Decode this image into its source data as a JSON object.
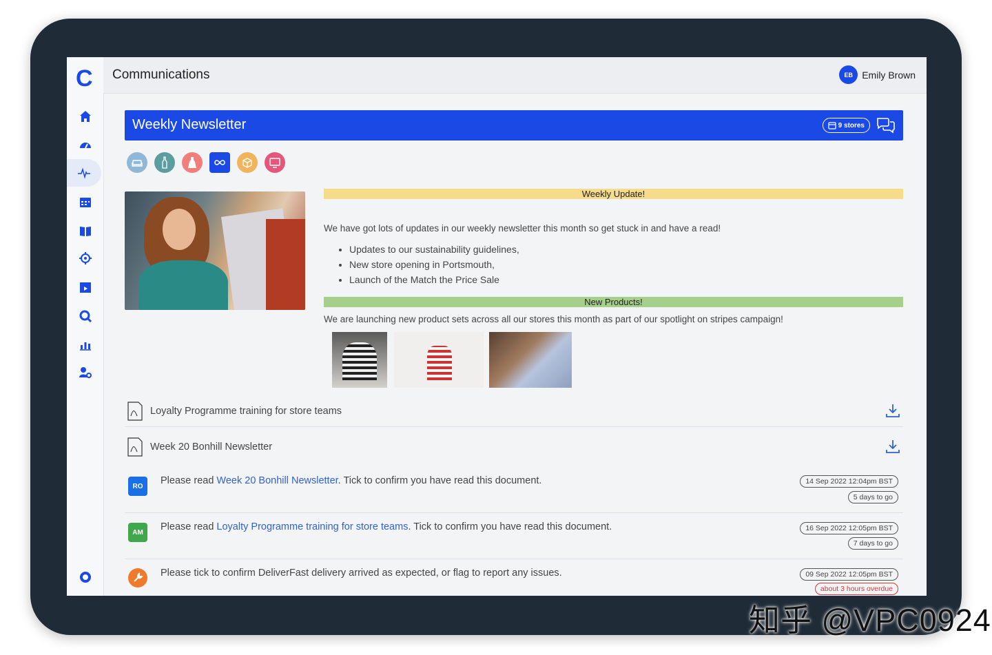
{
  "app": {
    "logo": "C",
    "title": "Communications"
  },
  "user": {
    "initials": "EB",
    "name": "Emily Brown"
  },
  "banner": {
    "title": "Weekly Newsletter",
    "stores": "9 stores"
  },
  "categories": [
    {
      "icon": "sofa-icon",
      "color": "#8fb8d8"
    },
    {
      "icon": "bottle-icon",
      "color": "#5c9da0"
    },
    {
      "icon": "dress-icon",
      "color": "#f07f7b"
    },
    {
      "icon": "infinity-icon",
      "color": "#1a49e6"
    },
    {
      "icon": "box-icon",
      "color": "#f2b45a"
    },
    {
      "icon": "monitor-icon",
      "color": "#e5577a"
    }
  ],
  "newsletter": {
    "section1_heading": "Weekly Update!",
    "intro": "We have got lots of updates in our weekly newsletter this month so get stuck in and have a read!",
    "bullets": [
      "Updates to our sustainability guidelines,",
      "New store opening in Portsmouth,",
      "Launch of the Match the Price Sale"
    ],
    "section2_heading": "New Products!",
    "products_text": "We are launching new product sets across all our stores this month as part of our spotlight on stripes campaign!"
  },
  "documents": [
    {
      "label": "Loyalty Programme training for store teams"
    },
    {
      "label": "Week 20 Bonhill Newsletter"
    }
  ],
  "tasks": [
    {
      "initials": "RO",
      "avatar_color": "#1a6ee6",
      "prefix": "Please read ",
      "link": "Week 20 Bonhill Newsletter",
      "suffix": ". Tick to confirm you have read this document.",
      "date": "14 Sep 2022 12:04pm BST",
      "status": "5 days to go"
    },
    {
      "initials": "AM",
      "avatar_color": "#3ea84a",
      "prefix": "Please read ",
      "link": "Loyalty Programme training for store teams",
      "suffix": ". Tick to confirm you have read this document.",
      "date": "16 Sep 2022 12:05pm BST",
      "status": "7 days to go"
    },
    {
      "initials": "",
      "avatar_color": "#f07a2c",
      "prefix": "Please tick to confirm DeliverFast delivery arrived as expected, or flag to report any issues.",
      "link": "",
      "suffix": "",
      "date": "09 Sep 2022 12:05pm BST",
      "status": "about 3 hours overdue"
    }
  ],
  "watermark": "知乎 @VPC0924",
  "colors": {
    "accent": "#1a49e6",
    "overdue": "#dd3333"
  }
}
